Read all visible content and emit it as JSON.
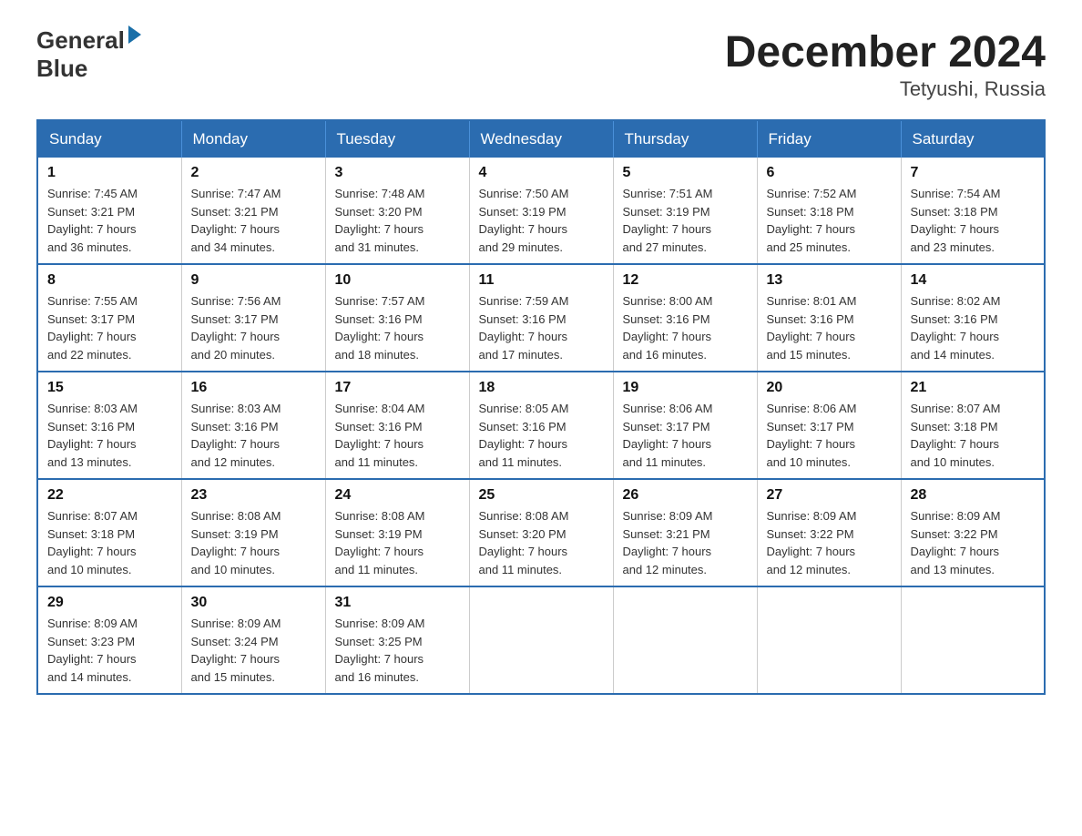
{
  "logo": {
    "line1": "General",
    "line2": "Blue"
  },
  "title": "December 2024",
  "subtitle": "Tetyushi, Russia",
  "days_of_week": [
    "Sunday",
    "Monday",
    "Tuesday",
    "Wednesday",
    "Thursday",
    "Friday",
    "Saturday"
  ],
  "weeks": [
    [
      {
        "day": "1",
        "sunrise": "7:45 AM",
        "sunset": "3:21 PM",
        "daylight": "7 hours and 36 minutes."
      },
      {
        "day": "2",
        "sunrise": "7:47 AM",
        "sunset": "3:21 PM",
        "daylight": "7 hours and 34 minutes."
      },
      {
        "day": "3",
        "sunrise": "7:48 AM",
        "sunset": "3:20 PM",
        "daylight": "7 hours and 31 minutes."
      },
      {
        "day": "4",
        "sunrise": "7:50 AM",
        "sunset": "3:19 PM",
        "daylight": "7 hours and 29 minutes."
      },
      {
        "day": "5",
        "sunrise": "7:51 AM",
        "sunset": "3:19 PM",
        "daylight": "7 hours and 27 minutes."
      },
      {
        "day": "6",
        "sunrise": "7:52 AM",
        "sunset": "3:18 PM",
        "daylight": "7 hours and 25 minutes."
      },
      {
        "day": "7",
        "sunrise": "7:54 AM",
        "sunset": "3:18 PM",
        "daylight": "7 hours and 23 minutes."
      }
    ],
    [
      {
        "day": "8",
        "sunrise": "7:55 AM",
        "sunset": "3:17 PM",
        "daylight": "7 hours and 22 minutes."
      },
      {
        "day": "9",
        "sunrise": "7:56 AM",
        "sunset": "3:17 PM",
        "daylight": "7 hours and 20 minutes."
      },
      {
        "day": "10",
        "sunrise": "7:57 AM",
        "sunset": "3:16 PM",
        "daylight": "7 hours and 18 minutes."
      },
      {
        "day": "11",
        "sunrise": "7:59 AM",
        "sunset": "3:16 PM",
        "daylight": "7 hours and 17 minutes."
      },
      {
        "day": "12",
        "sunrise": "8:00 AM",
        "sunset": "3:16 PM",
        "daylight": "7 hours and 16 minutes."
      },
      {
        "day": "13",
        "sunrise": "8:01 AM",
        "sunset": "3:16 PM",
        "daylight": "7 hours and 15 minutes."
      },
      {
        "day": "14",
        "sunrise": "8:02 AM",
        "sunset": "3:16 PM",
        "daylight": "7 hours and 14 minutes."
      }
    ],
    [
      {
        "day": "15",
        "sunrise": "8:03 AM",
        "sunset": "3:16 PM",
        "daylight": "7 hours and 13 minutes."
      },
      {
        "day": "16",
        "sunrise": "8:03 AM",
        "sunset": "3:16 PM",
        "daylight": "7 hours and 12 minutes."
      },
      {
        "day": "17",
        "sunrise": "8:04 AM",
        "sunset": "3:16 PM",
        "daylight": "7 hours and 11 minutes."
      },
      {
        "day": "18",
        "sunrise": "8:05 AM",
        "sunset": "3:16 PM",
        "daylight": "7 hours and 11 minutes."
      },
      {
        "day": "19",
        "sunrise": "8:06 AM",
        "sunset": "3:17 PM",
        "daylight": "7 hours and 11 minutes."
      },
      {
        "day": "20",
        "sunrise": "8:06 AM",
        "sunset": "3:17 PM",
        "daylight": "7 hours and 10 minutes."
      },
      {
        "day": "21",
        "sunrise": "8:07 AM",
        "sunset": "3:18 PM",
        "daylight": "7 hours and 10 minutes."
      }
    ],
    [
      {
        "day": "22",
        "sunrise": "8:07 AM",
        "sunset": "3:18 PM",
        "daylight": "7 hours and 10 minutes."
      },
      {
        "day": "23",
        "sunrise": "8:08 AM",
        "sunset": "3:19 PM",
        "daylight": "7 hours and 10 minutes."
      },
      {
        "day": "24",
        "sunrise": "8:08 AM",
        "sunset": "3:19 PM",
        "daylight": "7 hours and 11 minutes."
      },
      {
        "day": "25",
        "sunrise": "8:08 AM",
        "sunset": "3:20 PM",
        "daylight": "7 hours and 11 minutes."
      },
      {
        "day": "26",
        "sunrise": "8:09 AM",
        "sunset": "3:21 PM",
        "daylight": "7 hours and 12 minutes."
      },
      {
        "day": "27",
        "sunrise": "8:09 AM",
        "sunset": "3:22 PM",
        "daylight": "7 hours and 12 minutes."
      },
      {
        "day": "28",
        "sunrise": "8:09 AM",
        "sunset": "3:22 PM",
        "daylight": "7 hours and 13 minutes."
      }
    ],
    [
      {
        "day": "29",
        "sunrise": "8:09 AM",
        "sunset": "3:23 PM",
        "daylight": "7 hours and 14 minutes."
      },
      {
        "day": "30",
        "sunrise": "8:09 AM",
        "sunset": "3:24 PM",
        "daylight": "7 hours and 15 minutes."
      },
      {
        "day": "31",
        "sunrise": "8:09 AM",
        "sunset": "3:25 PM",
        "daylight": "7 hours and 16 minutes."
      },
      null,
      null,
      null,
      null
    ]
  ]
}
